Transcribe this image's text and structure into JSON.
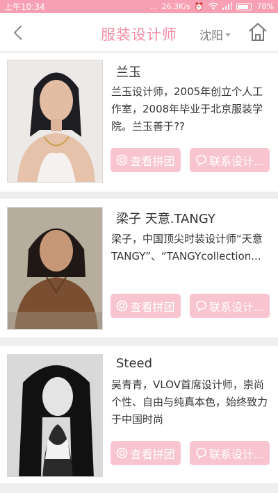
{
  "status_bar": {
    "time": "上午10:34",
    "dots": "...",
    "speed": "26.3K/s",
    "battery": "78%"
  },
  "nav": {
    "title": "服装设计师",
    "city": "沈阳"
  },
  "designers": [
    {
      "name": "兰玉",
      "desc": "兰玉设计师，2005年创立个人工作室，2008年毕业于北京服装学院。兰玉善于??",
      "btn_group": "查看拼团",
      "btn_contact": "联系设计..."
    },
    {
      "name": "梁子 天意.TANGY",
      "desc": "梁子，中国顶尖时装设计师“天意TANGY”、“TANGYcollection...",
      "btn_group": "查看拼团",
      "btn_contact": "联系设计..."
    },
    {
      "name": "Steed",
      "desc": "吴青青，VLOV首席设计师，崇尚个性、自由与纯真本色，始终致力于中国时尚",
      "btn_group": "查看拼团",
      "btn_contact": "联系设计..."
    }
  ],
  "colors": {
    "accent": "#f48aa3",
    "status_bar": "#f7a0b4",
    "button": "#f8c4cf"
  }
}
